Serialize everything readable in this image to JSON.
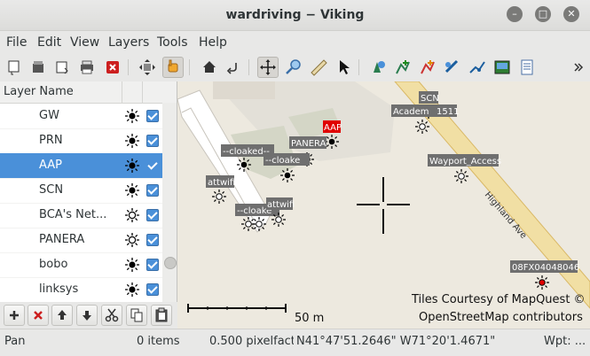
{
  "window": {
    "title": "wardriving − Viking"
  },
  "window_controls": {
    "minimize": "–",
    "maximize": "□",
    "close": "✕"
  },
  "menu": [
    "File",
    "Edit",
    "View",
    "Layers",
    "Tools",
    "Help"
  ],
  "layers_header": "Layer Name",
  "layers": [
    {
      "name": "GW",
      "visible": true,
      "selected": false
    },
    {
      "name": "PRN",
      "visible": true,
      "selected": false
    },
    {
      "name": "AAP",
      "visible": true,
      "selected": true
    },
    {
      "name": "SCN",
      "visible": true,
      "selected": false
    },
    {
      "name": "BCA's Net...",
      "visible": true,
      "selected": false
    },
    {
      "name": "PANERA",
      "visible": true,
      "selected": false
    },
    {
      "name": "bobo",
      "visible": true,
      "selected": false
    },
    {
      "name": "linksys",
      "visible": true,
      "selected": false
    }
  ],
  "map": {
    "road_label": "Highland Ave",
    "scale_label": "50 m",
    "attribution_line1": "Tiles Courtesy of MapQuest ©",
    "attribution_line2": "OpenStreetMap contributors",
    "waypoints": {
      "scn": "SCN",
      "academy": "Academ",
      "academy_suffix": "1511",
      "aap": "AAP",
      "panera": "PANERA",
      "cloaked1": "--cloaked--",
      "cloaked2": "--cloake",
      "cloaked3": "--cloake",
      "attwifi1": "attwifi",
      "attwifi2": "attwifi",
      "wayport": "Wayport_Access",
      "ob": "08FX04048046"
    }
  },
  "status": {
    "tool": "Pan",
    "items": "0 items",
    "zoom": "0.500 pixelfact",
    "coords": "N41°47'51.2646\" W71°20'1.4671\"",
    "wpt": "Wpt: ..."
  },
  "colors": {
    "selection": "#4a90d9",
    "map_bg": "#ede9df",
    "road": "#f1dfa4",
    "label_bg": "#6f6f6f",
    "label_red": "#e00000"
  }
}
